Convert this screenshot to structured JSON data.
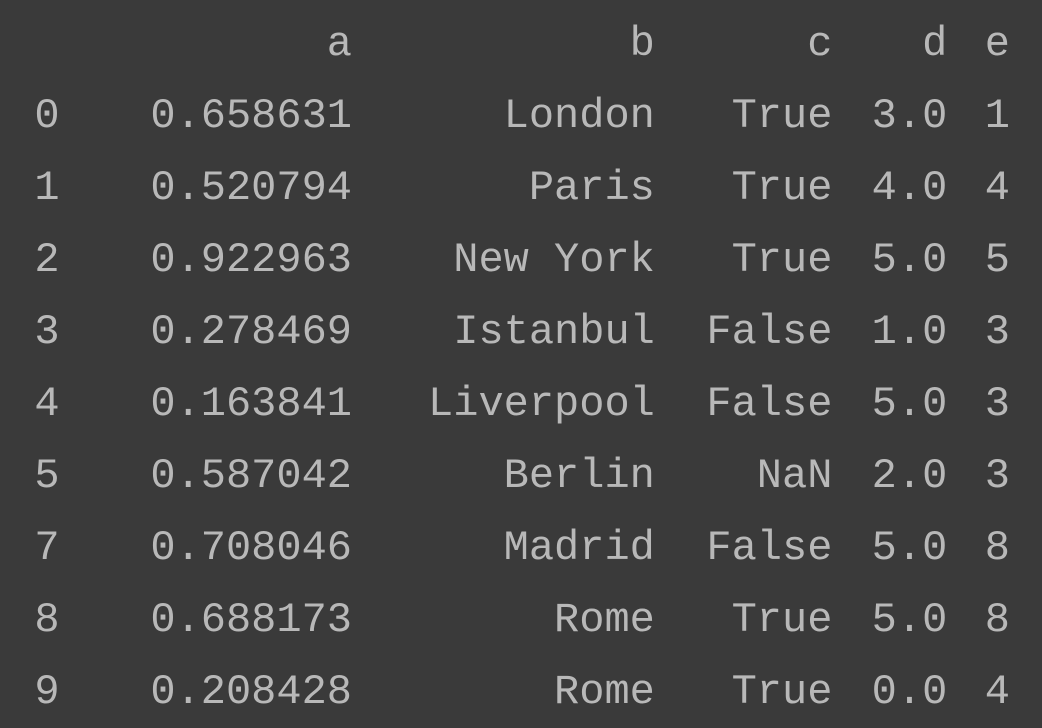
{
  "table": {
    "columns": [
      "",
      "a",
      "b",
      "c",
      "d",
      "e"
    ],
    "rows": [
      {
        "idx": "0",
        "a": "0.658631",
        "b": "London",
        "c": "True",
        "d": "3.0",
        "e": "1"
      },
      {
        "idx": "1",
        "a": "0.520794",
        "b": "Paris",
        "c": "True",
        "d": "4.0",
        "e": "4"
      },
      {
        "idx": "2",
        "a": "0.922963",
        "b": "New York",
        "c": "True",
        "d": "5.0",
        "e": "5"
      },
      {
        "idx": "3",
        "a": "0.278469",
        "b": "Istanbul",
        "c": "False",
        "d": "1.0",
        "e": "3"
      },
      {
        "idx": "4",
        "a": "0.163841",
        "b": "Liverpool",
        "c": "False",
        "d": "5.0",
        "e": "3"
      },
      {
        "idx": "5",
        "a": "0.587042",
        "b": "Berlin",
        "c": "NaN",
        "d": "2.0",
        "e": "3"
      },
      {
        "idx": "7",
        "a": "0.708046",
        "b": "Madrid",
        "c": "False",
        "d": "5.0",
        "e": "8"
      },
      {
        "idx": "8",
        "a": "0.688173",
        "b": "Rome",
        "c": "True",
        "d": "5.0",
        "e": "8"
      },
      {
        "idx": "9",
        "a": "0.208428",
        "b": "Rome",
        "c": "True",
        "d": "0.0",
        "e": "4"
      }
    ]
  }
}
